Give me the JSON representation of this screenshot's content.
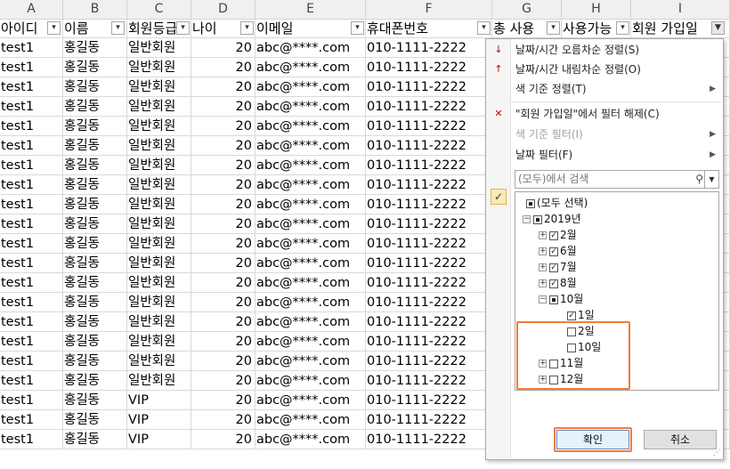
{
  "column_letters": [
    "A",
    "B",
    "C",
    "D",
    "E",
    "F",
    "G",
    "H",
    "I"
  ],
  "headers": [
    "아이디",
    "이름",
    "회원등급",
    "나이",
    "이메일",
    "휴대폰번호",
    "총 사용",
    "사용가능",
    "회원 가입일"
  ],
  "rows": [
    [
      "test1",
      "홍길동",
      "일반회원",
      "20",
      "abc@****.com",
      "010-1111-2222"
    ],
    [
      "test1",
      "홍길동",
      "일반회원",
      "20",
      "abc@****.com",
      "010-1111-2222"
    ],
    [
      "test1",
      "홍길동",
      "일반회원",
      "20",
      "abc@****.com",
      "010-1111-2222"
    ],
    [
      "test1",
      "홍길동",
      "일반회원",
      "20",
      "abc@****.com",
      "010-1111-2222"
    ],
    [
      "test1",
      "홍길동",
      "일반회원",
      "20",
      "abc@****.com",
      "010-1111-2222"
    ],
    [
      "test1",
      "홍길동",
      "일반회원",
      "20",
      "abc@****.com",
      "010-1111-2222"
    ],
    [
      "test1",
      "홍길동",
      "일반회원",
      "20",
      "abc@****.com",
      "010-1111-2222"
    ],
    [
      "test1",
      "홍길동",
      "일반회원",
      "20",
      "abc@****.com",
      "010-1111-2222"
    ],
    [
      "test1",
      "홍길동",
      "일반회원",
      "20",
      "abc@****.com",
      "010-1111-2222"
    ],
    [
      "test1",
      "홍길동",
      "일반회원",
      "20",
      "abc@****.com",
      "010-1111-2222"
    ],
    [
      "test1",
      "홍길동",
      "일반회원",
      "20",
      "abc@****.com",
      "010-1111-2222"
    ],
    [
      "test1",
      "홍길동",
      "일반회원",
      "20",
      "abc@****.com",
      "010-1111-2222"
    ],
    [
      "test1",
      "홍길동",
      "일반회원",
      "20",
      "abc@****.com",
      "010-1111-2222"
    ],
    [
      "test1",
      "홍길동",
      "일반회원",
      "20",
      "abc@****.com",
      "010-1111-2222"
    ],
    [
      "test1",
      "홍길동",
      "일반회원",
      "20",
      "abc@****.com",
      "010-1111-2222"
    ],
    [
      "test1",
      "홍길동",
      "일반회원",
      "20",
      "abc@****.com",
      "010-1111-2222"
    ],
    [
      "test1",
      "홍길동",
      "일반회원",
      "20",
      "abc@****.com",
      "010-1111-2222"
    ],
    [
      "test1",
      "홍길동",
      "일반회원",
      "20",
      "abc@****.com",
      "010-1111-2222"
    ],
    [
      "test1",
      "홍길동",
      "VIP",
      "20",
      "abc@****.com",
      "010-1111-2222"
    ],
    [
      "test1",
      "홍길동",
      "VIP",
      "20",
      "abc@****.com",
      "010-1111-2222"
    ],
    [
      "test1",
      "홍길동",
      "VIP",
      "20",
      "abc@****.com",
      "010-1111-2222"
    ]
  ],
  "filter_menu": {
    "sort_asc": "날짜/시간 오름차순 정렬(S)",
    "sort_desc": "날짜/시간 내림차순 정렬(O)",
    "sort_by_color": "색 기준 정렬(T)",
    "clear_filter": "\"회원 가입일\"에서 필터 해제(C)",
    "filter_by_color": "색 기준 필터(I)",
    "date_filter": "날짜 필터(F)",
    "search_placeholder": "(모두)에서 검색",
    "tree": {
      "select_all": "(모두 선택)",
      "year": "2019년",
      "months": [
        "2월",
        "6월",
        "7월",
        "8월",
        "10월",
        "11월",
        "12월"
      ],
      "days": [
        "1일",
        "2일",
        "10일"
      ]
    },
    "ok_label": "확인",
    "cancel_label": "취소"
  },
  "icons": {
    "sort_asc": "sort-ascending-icon",
    "sort_desc": "sort-descending-icon",
    "clear_filter": "clear-filter-icon",
    "search": "search-icon",
    "check": "check-icon"
  },
  "colors": {
    "highlight": "#f07d3a"
  }
}
